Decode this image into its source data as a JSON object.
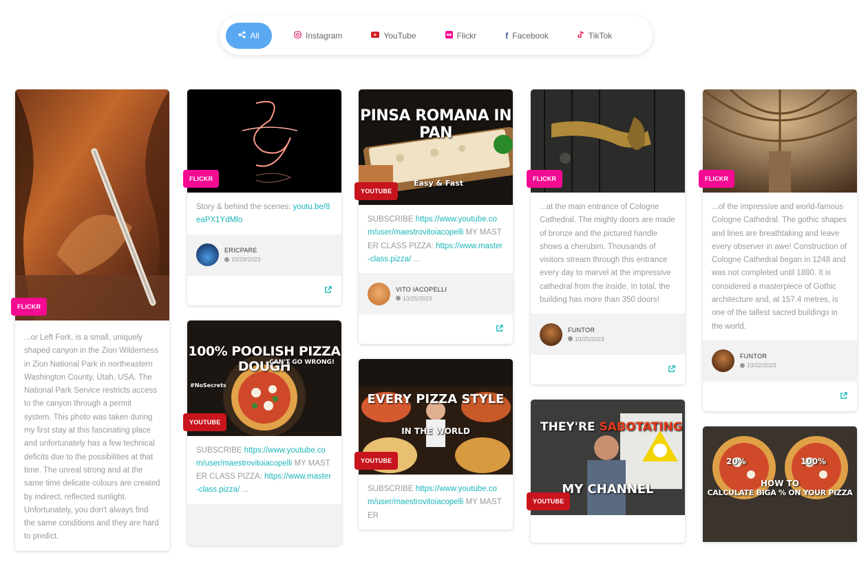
{
  "filters": [
    {
      "label": "All",
      "icon": "share-icon"
    },
    {
      "label": "Instagram",
      "icon": "instagram-icon"
    },
    {
      "label": "YouTube",
      "icon": "youtube-icon"
    },
    {
      "label": "Flickr",
      "icon": "flickr-icon"
    },
    {
      "label": "Facebook",
      "icon": "facebook-icon"
    },
    {
      "label": "TikTok",
      "icon": "tiktok-icon"
    }
  ],
  "colors": {
    "accent": "#5aa8f2",
    "flickr": "#f50a92",
    "youtube": "#c8141d",
    "link": "#1bb5b7"
  },
  "cards": {
    "zion": {
      "badge": "FLICKR",
      "text": "...or Left Fork, is a small, uniquely shaped canyon in the Zion Wilderness in Zion National Park in northeastern Washington County, Utah, USA. The National Park Service restricts access to the canyon through a permit system. This photo was taken during my first stay at this fascinating place and unfortunately has a few technical deficits due to the possibilities at that time. The unreal strong and at the same time delicate colours are created by indirect, reflected sunlight. Unfortunately, you don't always find the same conditions and they are hard to predict."
    },
    "story": {
      "badge": "FLICKR",
      "text": "Story & behind the scenes: ",
      "link": "youtu.be/8eaPX1YdMlo",
      "author": "ERICPARE",
      "date": "10/29/2023"
    },
    "poolish": {
      "badge": "YOUTUBE",
      "thumb_title": "100% POOLISH PIZZA DOUGH",
      "thumb_sub": "CAN'T GO WRONG!",
      "thumb_tag": "#NoSecrets",
      "text1": "SUBSCRIBE ",
      "link1": "https://www.youtube.com/user/maestrovitoiacopelli",
      "text2": " MY MASTER CLASS PIZZA: ",
      "link2": "https://www.master-class.pizza/",
      "text3": " ..."
    },
    "pinsa": {
      "badge": "YOUTUBE",
      "thumb_title": "PINSA ROMANA IN PAN",
      "thumb_sub": "Easy & Fast",
      "text1": "SUBSCRIBE ",
      "link1": "https://www.youtube.com/user/maestrovitoiacopelli",
      "text2": " MY MASTER CLASS PIZZA: ",
      "link2": "https://www.master-class.pizza/",
      "text3": " ...",
      "author": "VITO IACOPELLI",
      "date": "10/25/2023"
    },
    "every": {
      "badge": "YOUTUBE",
      "thumb_title": "EVERY PIZZA STYLE",
      "thumb_sub": "IN THE WORLD",
      "text1": "SUBSCRIBE ",
      "link1": "https://www.youtube.com/user/maestrovitoiacopelli",
      "text2": " MY MASTER"
    },
    "doors": {
      "badge": "FLICKR",
      "text": "...at the main entrance of Cologne Cathedral. The mighty doors are made of bronze and the pictured handle shows a cherubim. Thousands of visitors stream through this entrance every day to marvel at the impressive cathedral from the inside. In total, the building has more than 350 doors!",
      "author": "FUNTOR",
      "date": "10/25/2023"
    },
    "sabotage": {
      "badge": "YOUTUBE",
      "thumb_title_a": "THEY'RE ",
      "thumb_title_b": "SABOTATING",
      "thumb_sub": "MY CHANNEL"
    },
    "cathedral": {
      "badge": "FLICKR",
      "text": "...of the impressive and world-famous Cologne Cathedral. The gothic shapes and lines are breathtaking and leave every observer in awe! Construction of Cologne Cathedral began in 1248 and was not completed until 1880. It is considered a masterpiece of Gothic architecture and, at 157.4 metres, is one of the tallest sacred buildings in the world.",
      "author": "FUNTOR",
      "date": "10/22/2023"
    },
    "biga": {
      "thumb_l": "20%",
      "thumb_r": "100%",
      "thumb_title1": "HOW TO",
      "thumb_title2": "CALCULATE BIGA % ON YOUR PIZZA"
    }
  }
}
